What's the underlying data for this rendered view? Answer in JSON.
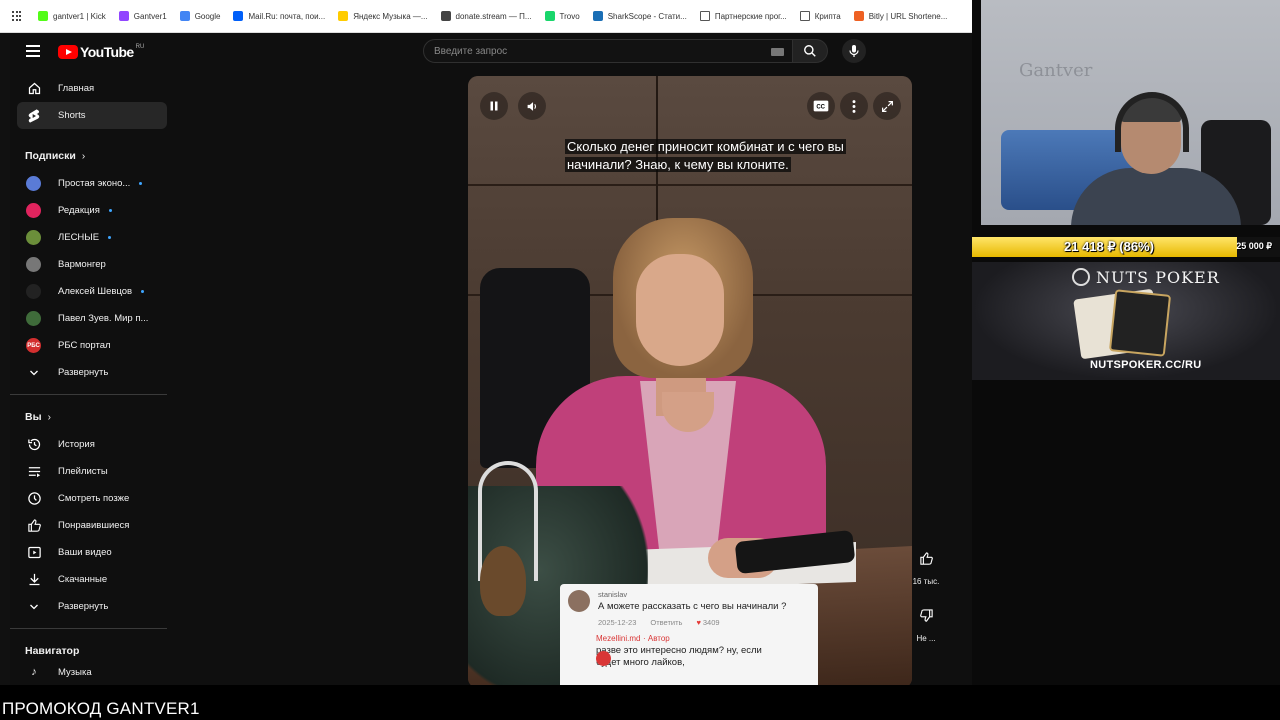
{
  "browser": {
    "bookmarks": [
      {
        "label": "gantver1 | Kick",
        "color": "#53fc18"
      },
      {
        "label": "Gantver1",
        "color": "#9146ff"
      },
      {
        "label": "Google",
        "color": "#4285f4"
      },
      {
        "label": "Mail.Ru: почта, пои...",
        "color": "#005ff9"
      },
      {
        "label": "Яндекс Музыка —...",
        "color": "#ffcc00"
      },
      {
        "label": "donate.stream — П...",
        "color": "#444444"
      },
      {
        "label": "Trovo",
        "color": "#19d66b"
      },
      {
        "label": "SharkScope - Стати...",
        "color": "#1a6eb5"
      },
      {
        "label": "Партнерские прог...",
        "color": "folder"
      },
      {
        "label": "Крипта",
        "color": "folder"
      },
      {
        "label": "Bitly | URL Shortene...",
        "color": "#ee6123"
      }
    ]
  },
  "youtube": {
    "logo": "YouTube",
    "country": "RU",
    "search": {
      "placeholder": "Введите запрос"
    },
    "sidebar": {
      "top": [
        {
          "label": "Главная",
          "icon": "home-icon"
        },
        {
          "label": "Shorts",
          "icon": "shorts-icon",
          "active": true
        }
      ],
      "subs_title": "Подписки",
      "subs": [
        {
          "label": "Простая эконо...",
          "color": "#5a7bd6",
          "new": true
        },
        {
          "label": "Редакция",
          "color": "#e0245e",
          "new": true
        },
        {
          "label": "ЛЕСНЫЕ",
          "color": "#6b8e3a",
          "new": true
        },
        {
          "label": "Вармонгер",
          "color": "#777777",
          "new": false
        },
        {
          "label": "Алексей Шевцов",
          "color": "#222222",
          "new": true
        },
        {
          "label": "Павел Зуев. Мир п...",
          "color": "#3f6b3a",
          "new": false
        },
        {
          "label": "РБС портал",
          "color": "#d32f2f",
          "avatar_text": "РБС",
          "new": false
        }
      ],
      "subs_expand": "Развернуть",
      "you_title": "Вы",
      "you": [
        {
          "label": "История",
          "icon": "history-icon"
        },
        {
          "label": "Плейлисты",
          "icon": "playlist-icon"
        },
        {
          "label": "Смотреть позже",
          "icon": "watch-later-icon"
        },
        {
          "label": "Понравившиеся",
          "icon": "like-icon"
        },
        {
          "label": "Ваши видео",
          "icon": "your-videos-icon"
        },
        {
          "label": "Скачанные",
          "icon": "download-icon"
        }
      ],
      "you_expand": "Развернуть",
      "nav_title": "Навигатор",
      "nav_partial": "Музыка"
    },
    "player": {
      "subtitle": "Сколько денег приносит комбинат и с чего вы начинали? Знаю, к чему вы клоните.",
      "comment": {
        "user": "stanislav",
        "text": "А можете рассказать с чего вы начинали ?",
        "date": "2025-12-23",
        "reply_label": "Ответить",
        "likes": "3409",
        "author_name": "Mezellini.md",
        "author_badge": "· Автор",
        "author_text": "разве это интересно людям? ну, если будет много лайков,"
      }
    },
    "actions": {
      "likes": "16 тыс.",
      "dislike_label": "Не ..."
    }
  },
  "stream": {
    "cam_text": "Gantver",
    "donation_progress": {
      "text": "21 418 ₽ (86%)",
      "goal": "25 000 ₽",
      "percent": 86
    },
    "banner": {
      "title": "NUTS POKER",
      "url": "NUTSPOKER.CC/RU"
    },
    "promo": "ПРОМОКОД GANTVER1"
  }
}
